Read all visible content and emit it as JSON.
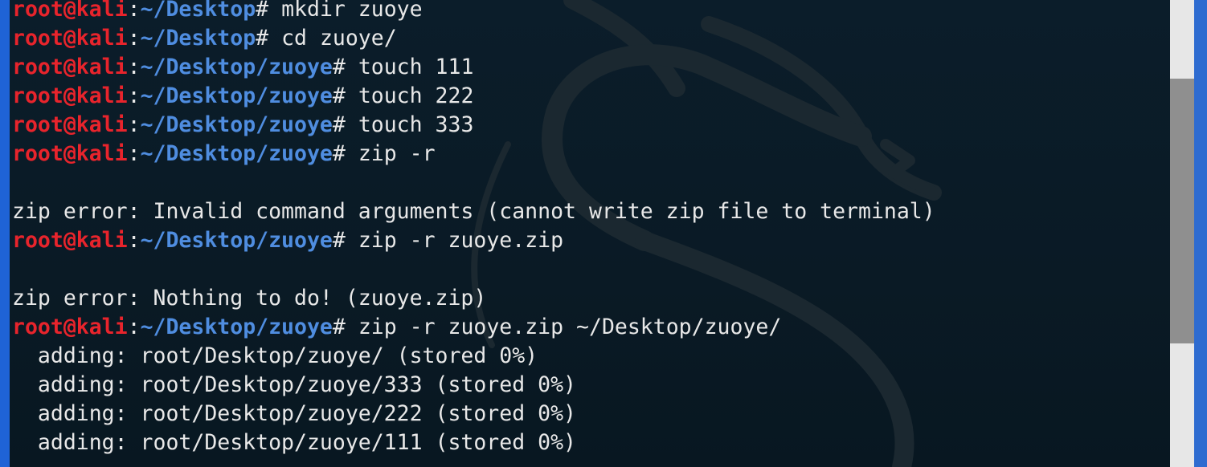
{
  "terminal": {
    "prompt_user": "root@kali",
    "lines": [
      {
        "type": "cmd",
        "path": "~/Desktop",
        "cmd": " mkdir zuoye"
      },
      {
        "type": "cmd",
        "path": "~/Desktop",
        "cmd": " cd zuoye/"
      },
      {
        "type": "cmd",
        "path": "~/Desktop/zuoye",
        "cmd": " touch 111"
      },
      {
        "type": "cmd",
        "path": "~/Desktop/zuoye",
        "cmd": " touch 222"
      },
      {
        "type": "cmd",
        "path": "~/Desktop/zuoye",
        "cmd": " touch 333"
      },
      {
        "type": "cmd",
        "path": "~/Desktop/zuoye",
        "cmd": " zip -r"
      },
      {
        "type": "out",
        "text": ""
      },
      {
        "type": "out",
        "text": "zip error: Invalid command arguments (cannot write zip file to terminal)"
      },
      {
        "type": "cmd",
        "path": "~/Desktop/zuoye",
        "cmd": " zip -r zuoye.zip"
      },
      {
        "type": "out",
        "text": ""
      },
      {
        "type": "out",
        "text": "zip error: Nothing to do! (zuoye.zip)"
      },
      {
        "type": "cmd",
        "path": "~/Desktop/zuoye",
        "cmd": " zip -r zuoye.zip ~/Desktop/zuoye/"
      },
      {
        "type": "out",
        "text": "  adding: root/Desktop/zuoye/ (stored 0%)"
      },
      {
        "type": "out",
        "text": "  adding: root/Desktop/zuoye/333 (stored 0%)"
      },
      {
        "type": "out",
        "text": "  adding: root/Desktop/zuoye/222 (stored 0%)"
      },
      {
        "type": "out",
        "text": "  adding: root/Desktop/zuoye/111 (stored 0%)"
      }
    ]
  },
  "icons": {
    "background": "kali-dragon-logo-icon"
  },
  "colors": {
    "background": "#0b1d2a",
    "prompt_user": "#e8242c",
    "prompt_path": "#4f8de0",
    "text": "#e8e8e8"
  }
}
